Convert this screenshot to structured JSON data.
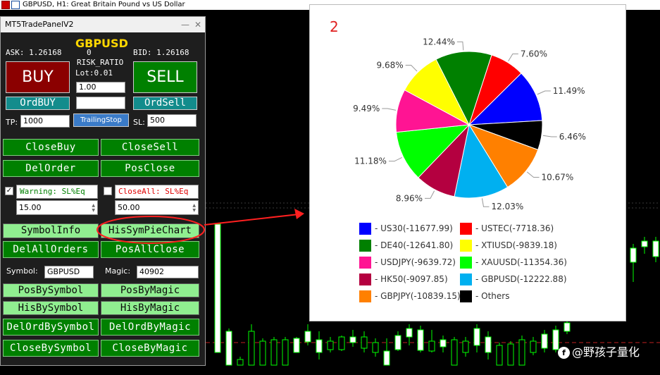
{
  "window": {
    "title": "GBPUSD, H1:  Great Britain Pound vs US Dollar"
  },
  "panel": {
    "title": "MT5TradePanelV2",
    "symbol_title": "GBPUSD",
    "ask": "ASK: 1.26168",
    "bid": "BID: 1.26168",
    "spread": "0",
    "risk_ratio": "RISK_RATIO",
    "lot": "Lot:0.01",
    "lot_value": "1.00",
    "buy": "BUY",
    "sell": "SELL",
    "ord_buy": "OrdBUY",
    "ord_sell": "OrdSell",
    "tp_label": "TP:",
    "tp_value": "1000",
    "trailing_stop": "TrailingStop",
    "sl_label": "SL:",
    "sl_value": "500",
    "close_buy": "CloseBuy",
    "close_sell": "CloseSell",
    "del_order": "DelOrder",
    "pos_close": "PosClose",
    "warning_label": "Warning: SL%Eq",
    "closeall_label": "CloseAll: SL%Eq",
    "warning_value": "15.00",
    "closeall_value": "50.00",
    "symbol_info": "SymbolInfo",
    "his_sym_pie_chart": "HisSymPieChart",
    "del_all_orders": "DelAllOrders",
    "pos_all_close": "PosAllClose",
    "symbol_label": "Symbol:",
    "symbol_value": "GBPUSD",
    "magic_label": "Magic:",
    "magic_value": "40902",
    "pos_by_symbol": "PosBySymbol",
    "pos_by_magic": "PosByMagic",
    "his_by_symbol": "HisBySymbol",
    "his_by_magic": "HisByMagic",
    "del_ord_by_symbol": "DelOrdBySymbol",
    "del_ord_by_magic": "DelOrdByMagic",
    "close_by_symbol": "CloseBySymbol",
    "close_by_magic": "CloseByMagic"
  },
  "chart_data": {
    "type": "pie",
    "title": "2",
    "slices": [
      {
        "label": "US30(-11677.99)",
        "value": 11.49,
        "pct": "11.49%",
        "color": "#0000ff"
      },
      {
        "label": "USTEC(-7718.36)",
        "value": 7.6,
        "pct": "7.60%",
        "color": "#ff0000"
      },
      {
        "label": "DE40(-12641.80)",
        "value": 12.44,
        "pct": "12.44%",
        "color": "#008000"
      },
      {
        "label": "XTIUSD(-9839.18)",
        "value": 9.68,
        "pct": "9.68%",
        "color": "#ffff00"
      },
      {
        "label": "USDJPY(-9639.72)",
        "value": 9.49,
        "pct": "9.49%",
        "color": "#ff1493"
      },
      {
        "label": "XAUUSD(-11354.36)",
        "value": 11.18,
        "pct": "11.18%",
        "color": "#00ff00"
      },
      {
        "label": "HK50(-9097.85)",
        "value": 8.96,
        "pct": "8.96%",
        "color": "#b40040"
      },
      {
        "label": "GBPUSD(-12222.88)",
        "value": 12.03,
        "pct": "12.03%",
        "color": "#00b0f0"
      },
      {
        "label": "GBPJPY(-10839.15)",
        "value": 10.67,
        "pct": "10.67%",
        "color": "#ff8000"
      },
      {
        "label": "Others",
        "value": 6.46,
        "pct": "6.46%",
        "color": "#000000"
      }
    ],
    "legend_position": "bottom"
  },
  "watermark": {
    "text": "@野孩子量化"
  },
  "colors": {
    "chart_bg": "#000000",
    "candle": "#00ff00",
    "buy_btn": "#8b0000",
    "sell_btn": "#008000",
    "symbol_title": "#ffd700",
    "annotation": "#ff2020"
  }
}
